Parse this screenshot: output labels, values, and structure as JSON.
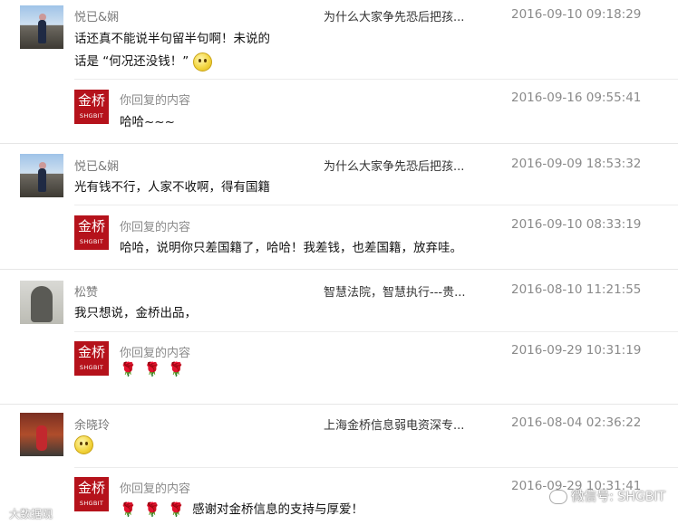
{
  "comments": [
    {
      "user": "悦已&娴",
      "article": "为什么大家争先恐后把孩...",
      "time": "2016-09-10 09:18:29",
      "text_line1": "话还真不能说半句留半句啊！未说的",
      "text_line2": "话是 “何况还没钱！”",
      "reply": {
        "label": "你回复的内容",
        "time": "2016-09-16 09:55:41",
        "text": "哈哈~~~"
      }
    },
    {
      "user": "悦已&娴",
      "article": "为什么大家争先恐后把孩...",
      "time": "2016-09-09 18:53:32",
      "text_line1": "光有钱不行，人家不收啊，得有国籍",
      "reply": {
        "label": "你回复的内容",
        "time": "2016-09-10 08:33:19",
        "text": "哈哈，说明你只差国籍了，哈哈！我差钱，也差国籍，放弃哇。"
      }
    },
    {
      "user": "松赞",
      "article": "智慧法院，智慧执行---贵...",
      "time": "2016-08-10 11:21:55",
      "text_line1": "我只想说，金桥出品，",
      "reply": {
        "label": "你回复的内容",
        "time": "2016-09-29 10:31:19"
      }
    },
    {
      "user": "余晓玲",
      "article": "上海金桥信息弱电资深专...",
      "time": "2016-08-04 02:36:22",
      "reply": {
        "label": "你回复的内容",
        "time": "2016-09-29 10:31:41",
        "text": "感谢对金桥信息的支持与厚爱！"
      }
    }
  ],
  "logo": {
    "mark": "金桥",
    "sub": "SHGBIT"
  },
  "watermark": {
    "left": "大数据观",
    "right": "微信号: SHGBIT"
  },
  "icons": {
    "rose": "rose-icon",
    "smiley": "smiley-icon",
    "wechat": "wechat-icon"
  },
  "colors": {
    "brand": "#b5121b",
    "meta": "#8a8a8a",
    "rose": "#d21a1a"
  }
}
